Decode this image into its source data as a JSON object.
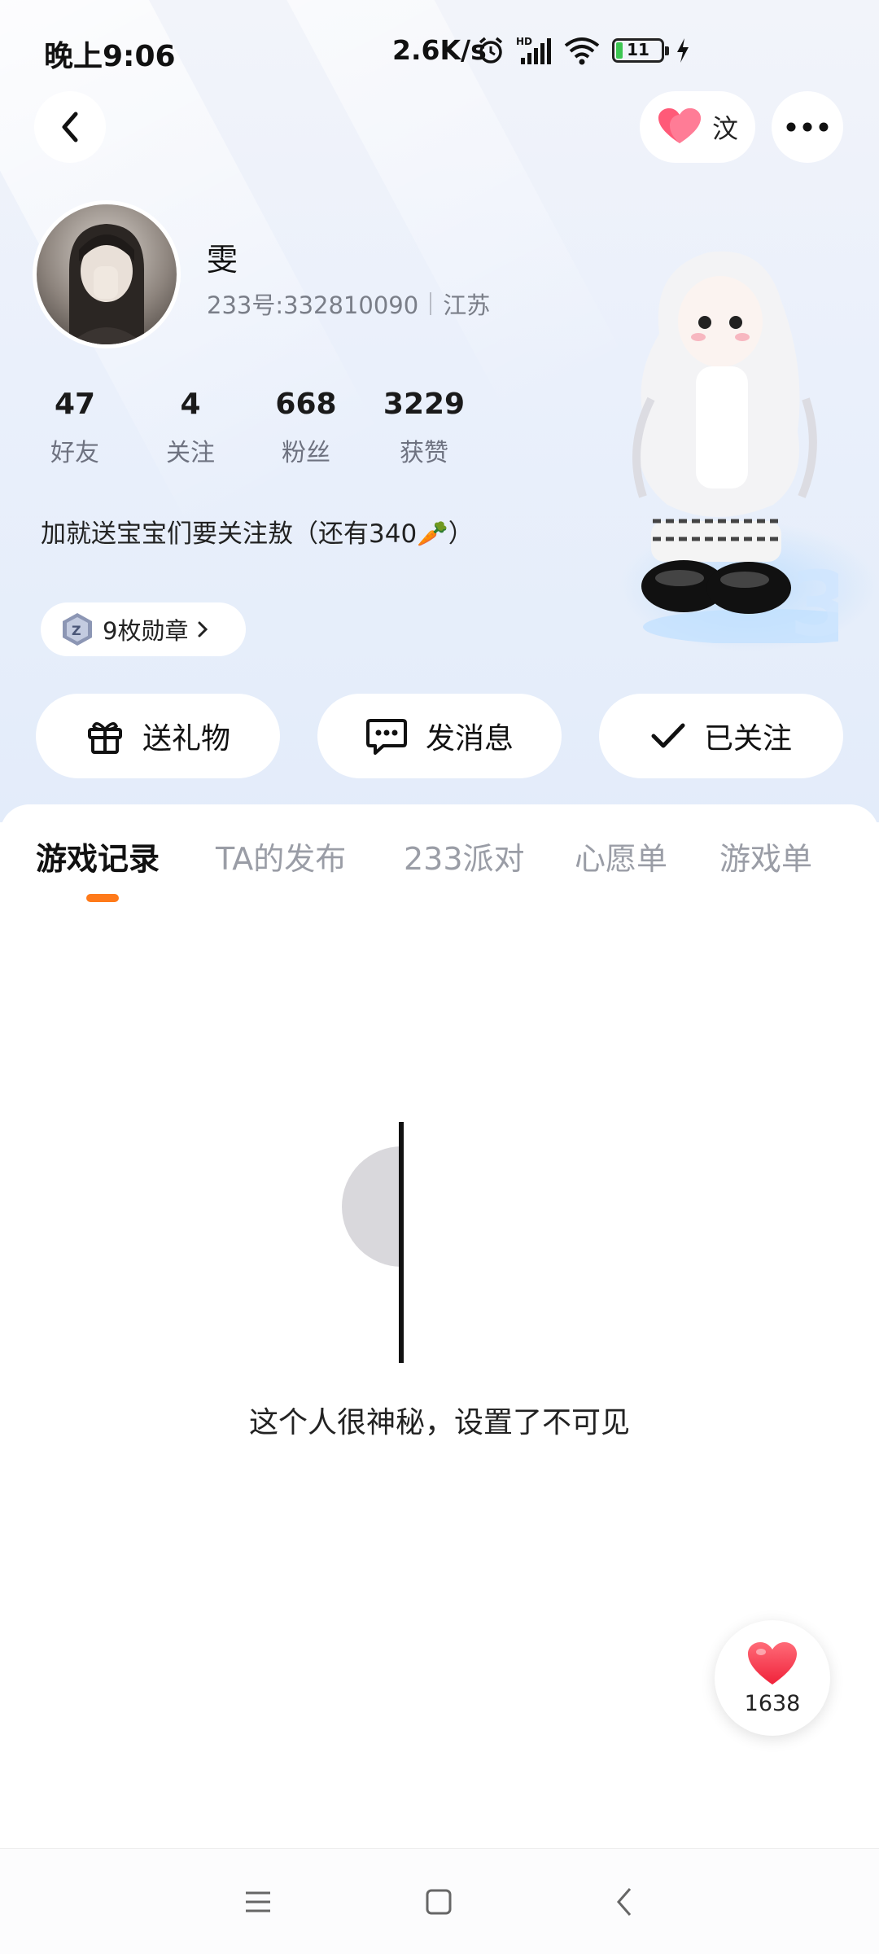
{
  "status_bar": {
    "time": "晚上9:06",
    "network_speed": "2.6K/s",
    "battery_level": "11"
  },
  "header": {
    "intimacy_label": "汶",
    "icons": {
      "back": "back-icon",
      "heart": "heart-icon",
      "more": "more-icon"
    }
  },
  "profile": {
    "nickname": "雯",
    "uid": "233号:332810090",
    "region": "江苏",
    "bio": "加就送宝宝们要关注敖（还有340🥕）",
    "stats": [
      {
        "value": "47",
        "label": "好友"
      },
      {
        "value": "4",
        "label": "关注"
      },
      {
        "value": "668",
        "label": "粉丝"
      },
      {
        "value": "3229",
        "label": "获赞"
      }
    ],
    "badges_label": "9枚勋章"
  },
  "actions": {
    "gift": "送礼物",
    "message": "发消息",
    "following": "已关注"
  },
  "tabs": [
    {
      "label": "游戏记录",
      "active": true
    },
    {
      "label": "TA的发布",
      "active": false
    },
    {
      "label": "233派对",
      "active": false
    },
    {
      "label": "心愿单",
      "active": false
    },
    {
      "label": "游戏单",
      "active": false
    }
  ],
  "empty_state": {
    "message": "这个人很神秘，设置了不可见"
  },
  "like_fab": {
    "count": "1638"
  },
  "colors": {
    "accent": "#ff7a1a",
    "heart": "#ff4a5a",
    "header_bg": "#e8eefa"
  }
}
